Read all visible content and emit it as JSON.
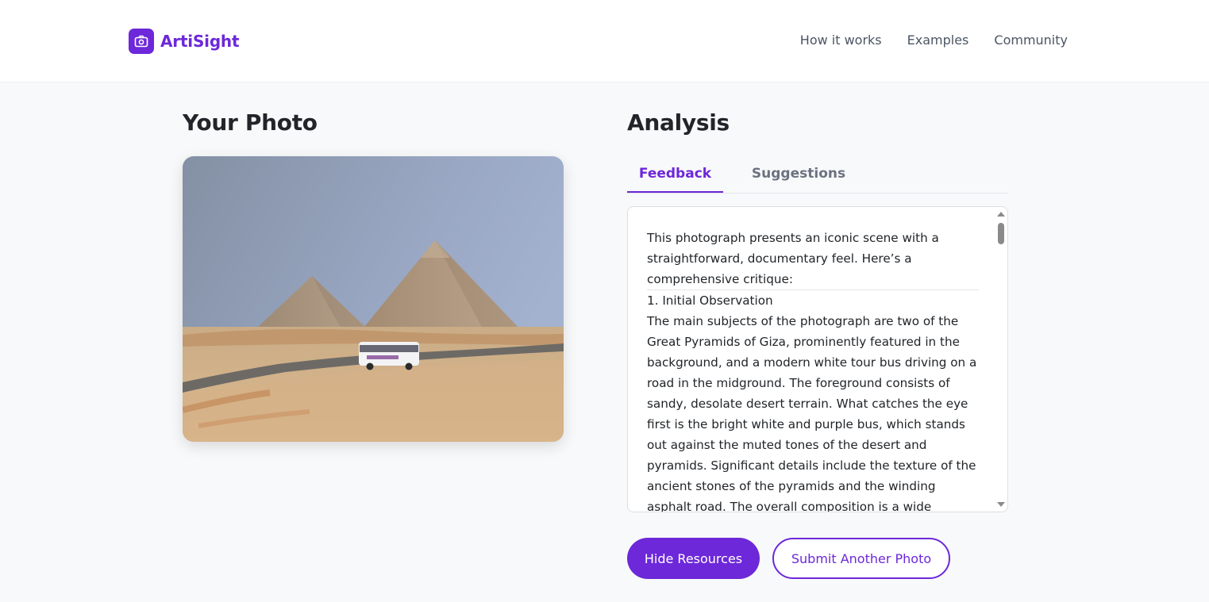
{
  "app": {
    "name": "ArtiSight",
    "icon": "camera-icon",
    "accent_color": "#6d28d9"
  },
  "nav": {
    "items": [
      "How it works",
      "Examples",
      "Community"
    ]
  },
  "left": {
    "title": "Your Photo"
  },
  "right": {
    "title": "Analysis",
    "tabs": [
      {
        "label": "Feedback",
        "active": true
      },
      {
        "label": "Suggestions",
        "active": false
      }
    ],
    "feedback": {
      "intro": "This photograph presents an iconic scene with a straightforward, documentary feel. Here’s a comprehensive critique:",
      "heading": "1. Initial Observation",
      "body": "The main subjects of the photograph are two of the Great Pyramids of Giza, prominently featured in the background, and a modern white tour bus driving on a road in the midground. The foreground consists of sandy, desolate desert terrain. What catches the eye first is the bright white and purple bus, which stands out against the muted tones of the desert and pyramids. Significant details include the texture of the ancient stones of the pyramids and the winding asphalt road. The overall composition is a wide"
    }
  },
  "buttons": {
    "hide_resources": "Hide Resources",
    "submit_another": "Submit Another Photo"
  }
}
